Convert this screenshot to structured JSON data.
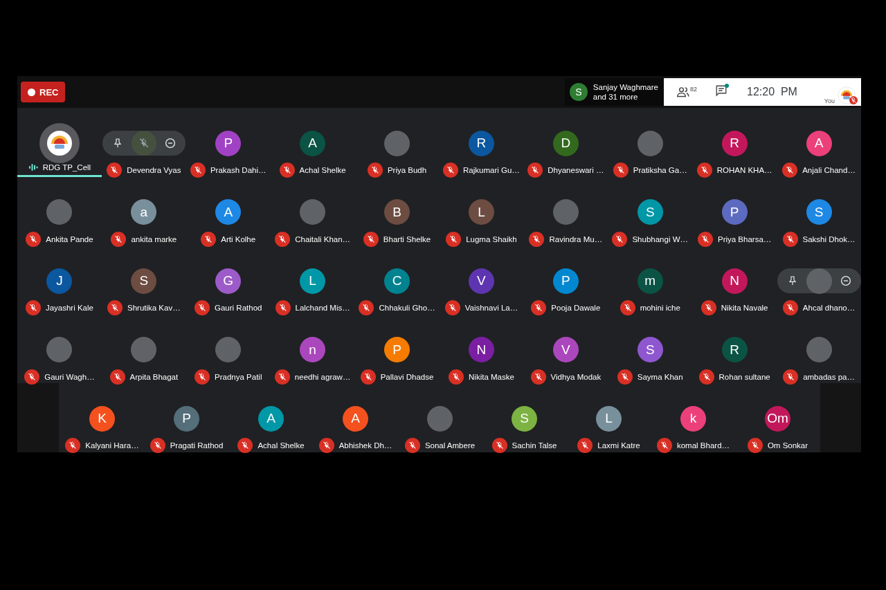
{
  "top_bar": {
    "rec_label": "REC",
    "speaker": {
      "initial": "S",
      "color": "#2e7d32",
      "name": "Sanjay Waghmare",
      "more": "and 31 more"
    },
    "people_count": "82",
    "chat_unread": true,
    "time": "12:20  PM",
    "self_label": "You",
    "self_muted": true
  },
  "grid_rows": [
    [
      {
        "name": "RDG TP_Cell",
        "kind": "logo",
        "muted": false,
        "highlighted": true,
        "hover_controls": false
      },
      {
        "name": "Devendra Vyas",
        "kind": "none",
        "muted": true,
        "highlighted": false,
        "hover_controls": true
      },
      {
        "name": "Prakash Dahi…",
        "kind": "letter",
        "letter": "P",
        "color": "#a142c4",
        "muted": true,
        "highlighted": false,
        "hover_controls": false
      },
      {
        "name": "Achal Shelke",
        "kind": "letter",
        "letter": "A",
        "color": "#0b5345",
        "muted": true,
        "highlighted": false,
        "hover_controls": false
      },
      {
        "name": "Priya Budh",
        "kind": "photo",
        "muted": true,
        "highlighted": false,
        "hover_controls": false
      },
      {
        "name": "Rajkumari Gu…",
        "kind": "letter",
        "letter": "R",
        "color": "#0b57a0",
        "muted": true,
        "highlighted": false,
        "hover_controls": false
      },
      {
        "name": "Dhyaneswari …",
        "kind": "letter",
        "letter": "D",
        "color": "#33691e",
        "muted": true,
        "highlighted": false,
        "hover_controls": false
      },
      {
        "name": "Pratiksha Ga…",
        "kind": "photo",
        "muted": true,
        "highlighted": false,
        "hover_controls": false
      },
      {
        "name": "ROHAN KHA…",
        "kind": "letter",
        "letter": "R",
        "color": "#c2185b",
        "muted": true,
        "highlighted": false,
        "hover_controls": false
      },
      {
        "name": "Anjali Chand…",
        "kind": "letter",
        "letter": "A",
        "color": "#ec407a",
        "muted": true,
        "highlighted": false,
        "hover_controls": false
      }
    ],
    [
      {
        "name": "Ankita Pande",
        "kind": "photo",
        "muted": true,
        "highlighted": false,
        "hover_controls": false
      },
      {
        "name": "ankita marke",
        "kind": "letter",
        "letter": "a",
        "color": "#78909c",
        "muted": true,
        "highlighted": false,
        "hover_controls": false
      },
      {
        "name": "Arti Kolhe",
        "kind": "letter",
        "letter": "A",
        "color": "#1e88e5",
        "muted": true,
        "highlighted": false,
        "hover_controls": false
      },
      {
        "name": "Chaitali Khan…",
        "kind": "photo",
        "muted": true,
        "highlighted": false,
        "hover_controls": false
      },
      {
        "name": "Bharti Shelke",
        "kind": "letter",
        "letter": "B",
        "color": "#6d4c41",
        "muted": true,
        "highlighted": false,
        "hover_controls": false
      },
      {
        "name": "Lugma Shaikh",
        "kind": "letter",
        "letter": "L",
        "color": "#6d4c41",
        "muted": true,
        "highlighted": false,
        "hover_controls": false
      },
      {
        "name": "Ravindra Mu…",
        "kind": "photo",
        "muted": true,
        "highlighted": false,
        "hover_controls": false
      },
      {
        "name": "Shubhangi W…",
        "kind": "letter",
        "letter": "S",
        "color": "#0097a7",
        "muted": true,
        "highlighted": false,
        "hover_controls": false
      },
      {
        "name": "Priya Bharsa…",
        "kind": "letter",
        "letter": "P",
        "color": "#5c6bc0",
        "muted": true,
        "highlighted": false,
        "hover_controls": false
      },
      {
        "name": "Sakshi Dhok…",
        "kind": "letter",
        "letter": "S",
        "color": "#1e88e5",
        "muted": true,
        "highlighted": false,
        "hover_controls": false
      }
    ],
    [
      {
        "name": "Jayashri Kale",
        "kind": "letter",
        "letter": "J",
        "color": "#0b57a0",
        "muted": true,
        "highlighted": false,
        "hover_controls": false
      },
      {
        "name": "Shrutika Kav…",
        "kind": "letter",
        "letter": "S",
        "color": "#6d4c41",
        "muted": true,
        "highlighted": false,
        "hover_controls": false
      },
      {
        "name": "Gauri Rathod",
        "kind": "letter",
        "letter": "G",
        "color": "#9c5bc8",
        "muted": true,
        "highlighted": false,
        "hover_controls": false
      },
      {
        "name": "Lalchand Mis…",
        "kind": "letter",
        "letter": "L",
        "color": "#0097a7",
        "muted": true,
        "highlighted": false,
        "hover_controls": false
      },
      {
        "name": "Chhakuli Gho…",
        "kind": "letter",
        "letter": "C",
        "color": "#00838f",
        "muted": true,
        "highlighted": false,
        "hover_controls": false
      },
      {
        "name": "Vaishnavi La…",
        "kind": "letter",
        "letter": "V",
        "color": "#5e35b1",
        "muted": true,
        "highlighted": false,
        "hover_controls": false
      },
      {
        "name": "Pooja Dawale",
        "kind": "letter",
        "letter": "P",
        "color": "#0288d1",
        "muted": true,
        "highlighted": false,
        "hover_controls": false
      },
      {
        "name": "mohini iche",
        "kind": "letter",
        "letter": "m",
        "color": "#0b5345",
        "muted": true,
        "highlighted": false,
        "hover_controls": false
      },
      {
        "name": "Nikita Navale",
        "kind": "letter",
        "letter": "N",
        "color": "#c2185b",
        "muted": true,
        "highlighted": false,
        "hover_controls": false
      },
      {
        "name": "Ahcal dhano…",
        "kind": "photo",
        "muted": true,
        "highlighted": false,
        "hover_controls": true
      }
    ],
    [
      {
        "name": "Gauri Wagh…",
        "kind": "photo",
        "muted": true,
        "highlighted": false,
        "hover_controls": false
      },
      {
        "name": "Arpita Bhagat",
        "kind": "photo",
        "muted": true,
        "highlighted": false,
        "hover_controls": false
      },
      {
        "name": "Pradnya Patil",
        "kind": "photo",
        "muted": true,
        "highlighted": false,
        "hover_controls": false
      },
      {
        "name": "needhi agraw…",
        "kind": "letter",
        "letter": "n",
        "color": "#ab47bc",
        "muted": true,
        "highlighted": false,
        "hover_controls": false
      },
      {
        "name": "Pallavi Dhadse",
        "kind": "letter",
        "letter": "P",
        "color": "#f57c00",
        "muted": true,
        "highlighted": false,
        "hover_controls": false
      },
      {
        "name": "Nikita Maske",
        "kind": "letter",
        "letter": "N",
        "color": "#7b1fa2",
        "muted": true,
        "highlighted": false,
        "hover_controls": false
      },
      {
        "name": "Vidhya Modak",
        "kind": "letter",
        "letter": "V",
        "color": "#ab47bc",
        "muted": true,
        "highlighted": false,
        "hover_controls": false
      },
      {
        "name": "Sayma Khan",
        "kind": "letter",
        "letter": "S",
        "color": "#8e57d0",
        "muted": true,
        "highlighted": false,
        "hover_controls": false
      },
      {
        "name": "Rohan sultane",
        "kind": "letter",
        "letter": "R",
        "color": "#0b5345",
        "muted": true,
        "highlighted": false,
        "hover_controls": false
      },
      {
        "name": "ambadas pa…",
        "kind": "photo",
        "muted": true,
        "highlighted": false,
        "hover_controls": false
      }
    ]
  ],
  "last_row": [
    {
      "name": "Kalyani Hara…",
      "kind": "letter",
      "letter": "K",
      "color": "#f4511e",
      "muted": true,
      "highlighted": false,
      "hover_controls": false
    },
    {
      "name": "Pragati Rathod",
      "kind": "letter",
      "letter": "P",
      "color": "#546e7a",
      "muted": true,
      "highlighted": false,
      "hover_controls": false
    },
    {
      "name": "Achal Shelke",
      "kind": "letter",
      "letter": "A",
      "color": "#0097a7",
      "muted": true,
      "highlighted": false,
      "hover_controls": false
    },
    {
      "name": "Abhishek Dh…",
      "kind": "letter",
      "letter": "A",
      "color": "#f4511e",
      "muted": true,
      "highlighted": false,
      "hover_controls": false
    },
    {
      "name": "Sonal Ambere",
      "kind": "photo",
      "muted": true,
      "highlighted": false,
      "hover_controls": false
    },
    {
      "name": "Sachin Talse",
      "kind": "letter",
      "letter": "S",
      "color": "#7cb342",
      "muted": true,
      "highlighted": false,
      "hover_controls": false
    },
    {
      "name": "Laxmi Katre",
      "kind": "letter",
      "letter": "L",
      "color": "#78909c",
      "muted": true,
      "highlighted": false,
      "hover_controls": false
    },
    {
      "name": "komal Bhard…",
      "kind": "letter",
      "letter": "k",
      "color": "#ec407a",
      "muted": true,
      "highlighted": false,
      "hover_controls": false
    },
    {
      "name": "Om Sonkar",
      "kind": "letter",
      "letter": "Om",
      "color": "#c2185b",
      "muted": true,
      "highlighted": false,
      "hover_controls": false
    }
  ]
}
